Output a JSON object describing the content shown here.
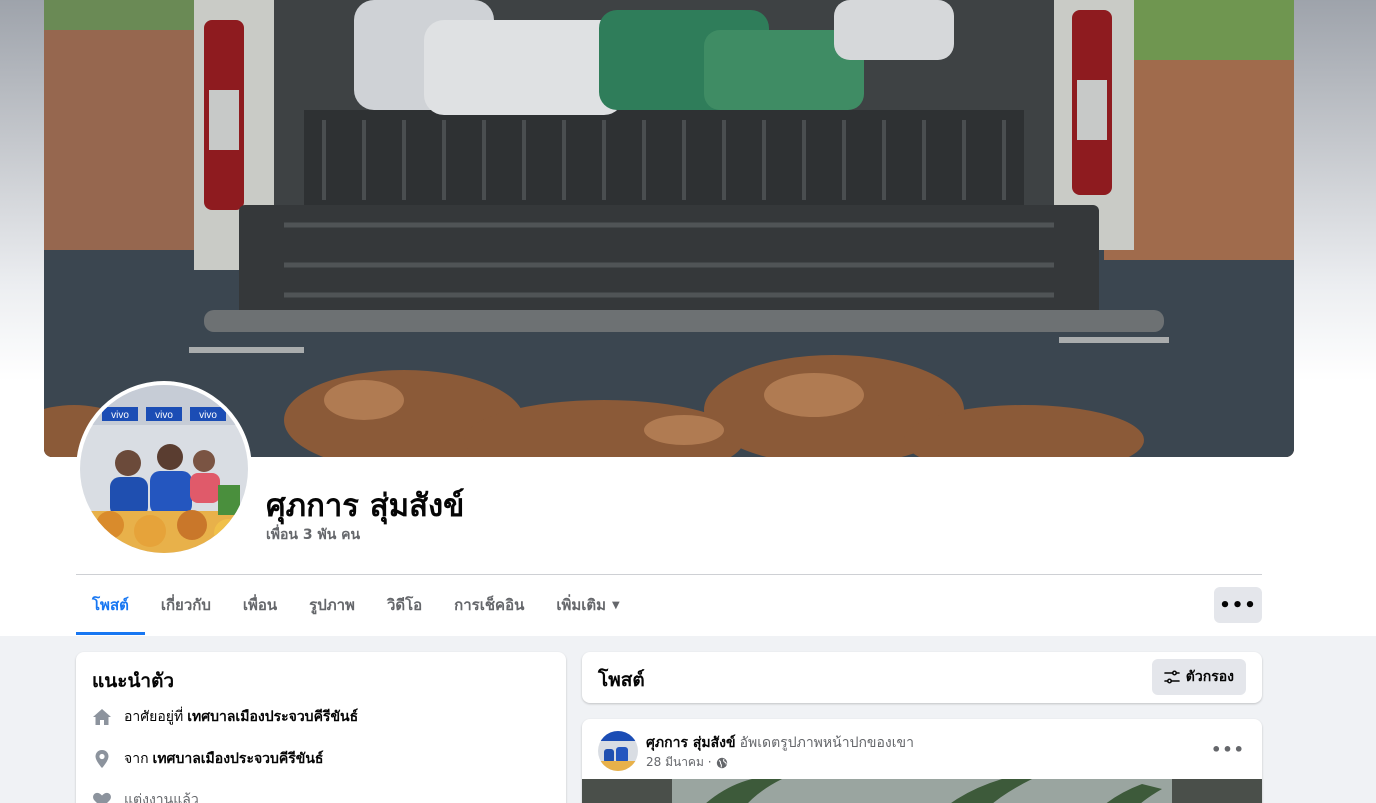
{
  "profile": {
    "name": "ศุภการ สุ่มสังข์",
    "friends": "เพื่อน 3 พัน คน"
  },
  "nav": {
    "tabs": [
      {
        "label": "โพสต์",
        "active": true
      },
      {
        "label": "เกี่ยวกับ"
      },
      {
        "label": "เพื่อน"
      },
      {
        "label": "รูปภาพ"
      },
      {
        "label": "วิดีโอ"
      },
      {
        "label": "การเช็คอิน"
      },
      {
        "label": "เพิ่มเติม"
      }
    ],
    "more_button": "•••"
  },
  "intro": {
    "title": "แนะนำตัว",
    "items": [
      {
        "icon": "home-icon",
        "label": "อาศัยอยู่ที่",
        "value": "เทศบาลเมืองประจวบคีรีขันธ์"
      },
      {
        "icon": "location-pin-icon",
        "label": "จาก",
        "value": "เทศบาลเมืองประจวบคีรีขันธ์"
      },
      {
        "icon": "heart-icon",
        "label": "แต่งงานแล้ว",
        "value": ""
      }
    ]
  },
  "posts": {
    "title": "โพสต์",
    "filter_label": "ตัวกรอง"
  },
  "post": {
    "author": "ศุภการ สุ่มสังข์",
    "action": "อัพเดตรูปภาพหน้าปกของเขา",
    "date": "28 มีนาคม ·",
    "menu": "•••"
  },
  "avatar_text": "vivo",
  "colors": {
    "accent": "#1877f2",
    "background": "#f0f2f5",
    "secondary_text": "#65676b"
  }
}
